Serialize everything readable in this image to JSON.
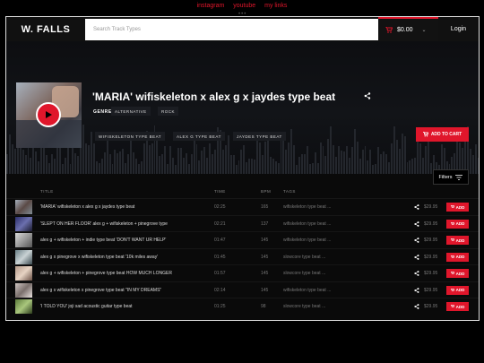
{
  "top_links": [
    "instagram",
    "youtube",
    "my links"
  ],
  "header": {
    "logo": "W. FALLS",
    "search_placeholder": "Search Track Types",
    "cart_total": "$0.00",
    "login_label": "Login"
  },
  "featured": {
    "title": "'MARIA' wifiskeleton x alex g x jaydes type beat",
    "genre_label": "GENRE",
    "genres": [
      "ALTERNATIVE",
      "ROCK"
    ],
    "tags": [
      "WIFISKELETON TYPE BEAT",
      "ALEX G TYPE BEAT",
      "JAYDES TYPE BEAT"
    ],
    "add_to_cart_label": "ADD TO CART"
  },
  "filters_label": "Filters",
  "table": {
    "columns": [
      "TITLE",
      "TIME",
      "BPM",
      "TAGS"
    ],
    "add_label": "ADD",
    "rows": [
      {
        "title": "'MARIA' wifiskeleton x alex g x jaydes type beat",
        "time": "02:25",
        "bpm": "165",
        "tags": "wifiskeleton type beat ...",
        "price": "$29.95"
      },
      {
        "title": "'SLEPT ON HER FLOOR' alex g + wifiskeleton + pinegrove type",
        "time": "02:21",
        "bpm": "137",
        "tags": "wifiskeleton type beat ...",
        "price": "$29.95"
      },
      {
        "title": "alex g + wifiskeleton + indie type beat 'DON'T WANT UR HELP'",
        "time": "01:47",
        "bpm": "145",
        "tags": "wifiskeleton type beat ...",
        "price": "$29.95"
      },
      {
        "title": "alex g x pinegrove x wifiskeleton type beat '10k miles away'",
        "time": "01:45",
        "bpm": "145",
        "tags": "slowcore type beat ...",
        "price": "$29.95"
      },
      {
        "title": "alex g + wifiskeleton + pinegrove type beat HOW MUCH LONGER",
        "time": "01:57",
        "bpm": "145",
        "tags": "slowcore type beat ...",
        "price": "$29.95"
      },
      {
        "title": "alex g x wifiskeleton x pinegrove type beat \"IN MY DREAMS\"",
        "time": "02:14",
        "bpm": "145",
        "tags": "wifiskeleton type beat ...",
        "price": "$29.95"
      },
      {
        "title": "'I TOLD YOU' joji sad acoustic guitar type beat",
        "time": "01:25",
        "bpm": "98",
        "tags": "slowcore type beat ...",
        "price": "$29.95"
      }
    ]
  },
  "colors": {
    "accent": "#e0162b",
    "background": "#0a0a0a"
  }
}
